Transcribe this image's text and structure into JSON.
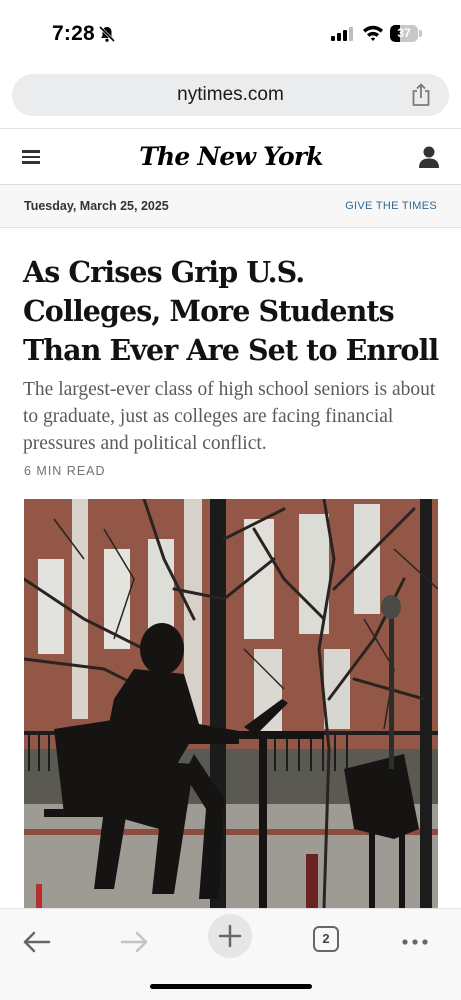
{
  "status_bar": {
    "time": "7:28",
    "battery_level": "37",
    "battery_fraction": 0.37
  },
  "browser": {
    "url": "nytimes.com",
    "open_tab_count": "2"
  },
  "site_header": {
    "masthead": "The New York Times"
  },
  "date_strip": {
    "date": "Tuesday, March 25, 2025",
    "give_link": "GIVE THE TIMES"
  },
  "article": {
    "headline": "As Crises Grip U.S. Colleges, More Students Than Ever Are Set to Enroll",
    "summary": "The largest-ever class of high school seniors is about to graduate, just as colleges are facing financial pressures and political conflict.",
    "read_time": "6 MIN READ"
  },
  "icons": {
    "status": [
      "bell-slash-icon",
      "cellular-signal-icon",
      "wifi-icon",
      "battery-icon"
    ],
    "browser": [
      "share-icon"
    ],
    "header": [
      "menu-icon",
      "account-icon"
    ],
    "toolbar": [
      "back-arrow-icon",
      "forward-arrow-icon",
      "plus-icon",
      "tabs-icon",
      "more-dots-icon"
    ]
  },
  "colors": {
    "link_blue": "#326891",
    "text_primary": "#121212",
    "summary_gray": "#5a5a5a"
  }
}
